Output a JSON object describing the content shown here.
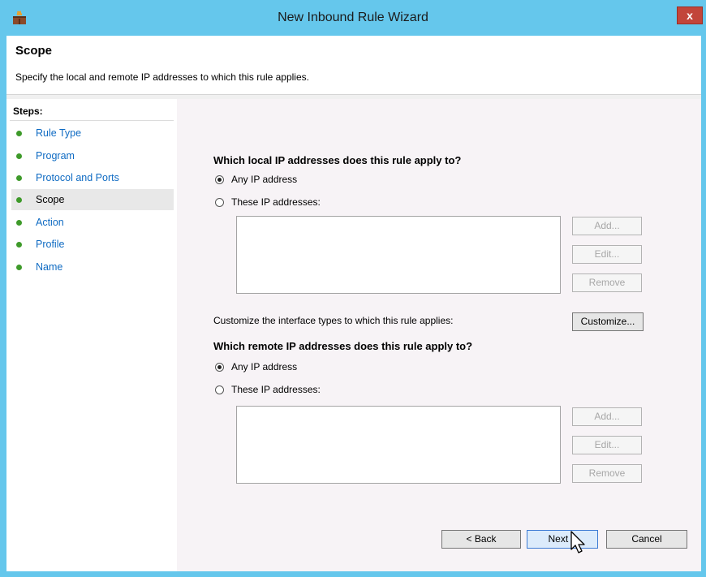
{
  "window": {
    "title": "New Inbound Rule Wizard",
    "close_label": "x"
  },
  "header": {
    "title": "Scope",
    "description": "Specify the local and remote IP addresses to which this rule applies."
  },
  "steps": {
    "title": "Steps:",
    "items": [
      {
        "label": "Rule Type"
      },
      {
        "label": "Program"
      },
      {
        "label": "Protocol and Ports"
      },
      {
        "label": "Scope"
      },
      {
        "label": "Action"
      },
      {
        "label": "Profile"
      },
      {
        "label": "Name"
      }
    ],
    "current": "Scope"
  },
  "local": {
    "question": "Which local IP addresses does this rule apply to?",
    "any_label": "Any IP address",
    "these_label": "These IP addresses:",
    "selected": "any",
    "add_label": "Add...",
    "edit_label": "Edit...",
    "remove_label": "Remove"
  },
  "customize": {
    "text": "Customize the interface types to which this rule applies:",
    "button_label": "Customize..."
  },
  "remote": {
    "question": "Which remote IP addresses does this rule apply to?",
    "any_label": "Any IP address",
    "these_label": "These IP addresses:",
    "selected": "any",
    "add_label": "Add...",
    "edit_label": "Edit...",
    "remove_label": "Remove"
  },
  "footer": {
    "back_label": "< Back",
    "next_label": "Next >",
    "cancel_label": "Cancel"
  },
  "colors": {
    "titlebar": "#65c7ec",
    "close": "#c2453a",
    "link": "#0f6bc3",
    "step_dot": "#3e9a2a"
  },
  "icons": {
    "app": "firewall-icon",
    "cursor": "mouse-pointer-icon"
  }
}
